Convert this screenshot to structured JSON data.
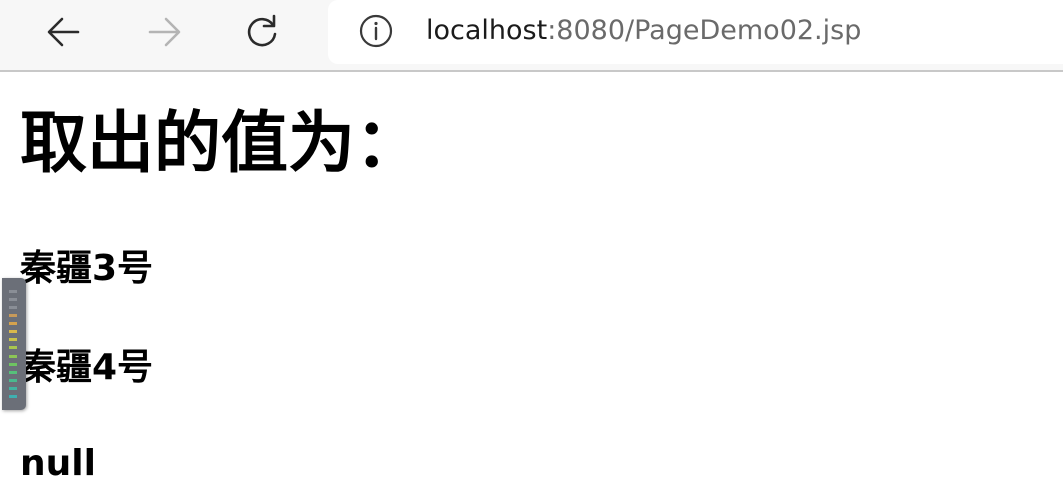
{
  "browser": {
    "url_host": "localhost",
    "url_rest": ":8080/PageDemo02.jsp"
  },
  "page": {
    "heading": "取出的值为：",
    "values": [
      "秦疆3号",
      "秦疆4号",
      "null"
    ]
  },
  "colors": {
    "toolbar_bg": "#f7f7f7",
    "icon": "#2b2b2b",
    "icon_disabled": "#b4b4b4",
    "url_host": "#1b1b1b",
    "url_rest": "#6a6a6a",
    "widget_bg": "#6b6f78"
  },
  "icons": [
    "back-arrow-icon",
    "forward-arrow-icon",
    "reload-icon",
    "info-icon"
  ]
}
